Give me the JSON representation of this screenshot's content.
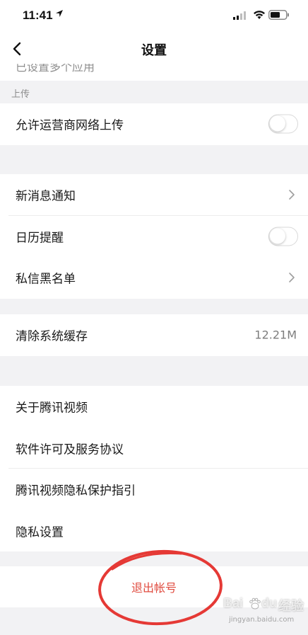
{
  "status_bar": {
    "time": "11:41"
  },
  "nav": {
    "title": "设置",
    "back_icon": "chevron-left-icon"
  },
  "cut_off_row": {
    "label": "已设置多个应用"
  },
  "upload_section": {
    "header": "上传",
    "rows": [
      {
        "label": "允许运营商网络上传",
        "toggle_on": false
      }
    ]
  },
  "notification_group": {
    "rows": [
      {
        "label": "新消息通知",
        "accessory": "chevron-right-icon"
      },
      {
        "label": "日历提醒",
        "toggle_on": false
      },
      {
        "label": "私信黑名单",
        "accessory": "chevron-right-icon"
      }
    ]
  },
  "cache_group": {
    "rows": [
      {
        "label": "清除系统缓存",
        "value": "12.21M"
      }
    ]
  },
  "about_group": {
    "rows": [
      {
        "label": "关于腾讯视频"
      },
      {
        "label": "软件许可及服务协议"
      },
      {
        "label": "腾讯视频隐私保护指引"
      },
      {
        "label": "隐私设置"
      }
    ]
  },
  "logout": {
    "label": "退出帐号",
    "color": "#e04b3f"
  },
  "annotation": {
    "ellipse_color": "#e53935"
  },
  "watermark": {
    "text": "Bai",
    "paw": "du",
    "suffix": "经验",
    "url": "jingyan.baidu.com"
  }
}
